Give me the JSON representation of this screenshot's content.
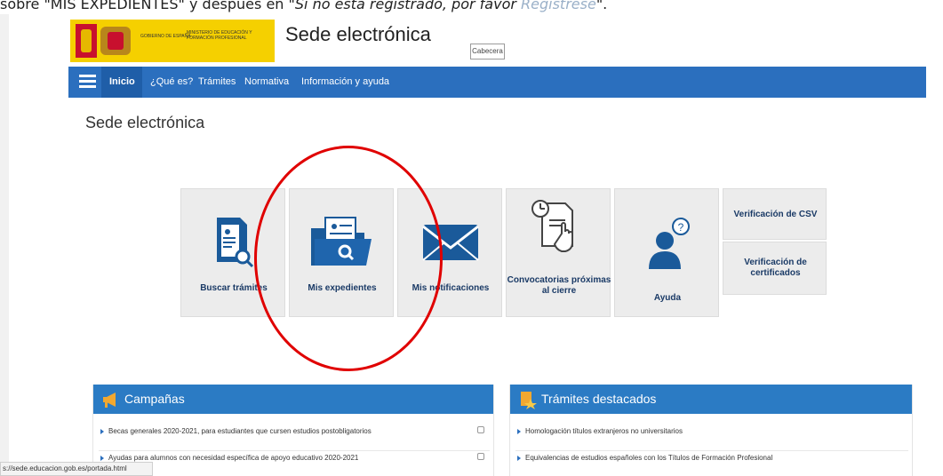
{
  "caption": {
    "prefix": "sobre \"MIS EXPEDIENTES\" y después en ",
    "italic": "\"Si no está registrado, por favor ",
    "link": "Regístrese",
    "suffix": "\"."
  },
  "header": {
    "logo_gobierno": "GOBIERNO DE ESPAÑA",
    "logo_ministerio": "MINISTERIO DE EDUCACIÓN Y FORMACIÓN PROFESIONAL",
    "site_title": "Sede electrónica",
    "cabecera": "Cabecera"
  },
  "nav": {
    "items": [
      "Inicio",
      "¿Qué es?",
      "Trámites",
      "Normativa",
      "Información y ayuda"
    ]
  },
  "page_title": "Sede electrónica",
  "tiles": [
    {
      "label": "Buscar trámites",
      "icon": "search-document-icon"
    },
    {
      "label": "Mis expedientes",
      "icon": "folder-search-icon"
    },
    {
      "label": "Mis notificaciones",
      "icon": "envelope-icon"
    },
    {
      "label": "Convocatorias próximas al cierre",
      "icon": "clock-document-icon"
    },
    {
      "label": "Ayuda",
      "icon": "user-help-icon"
    }
  ],
  "small_tiles": [
    {
      "label": "Verificación de CSV"
    },
    {
      "label": "Verificación de certificados"
    }
  ],
  "panels": {
    "campanas": {
      "title": "Campañas",
      "icon": "megaphone-icon",
      "items": [
        "Becas generales 2020-2021, para estudiantes que cursen estudios postobligatorios",
        "Ayudas para alumnos con necesidad específica de apoyo educativo 2020-2021"
      ]
    },
    "tramites": {
      "title": "Trámites destacados",
      "icon": "star-document-icon",
      "items": [
        "Homologación títulos extranjeros no universitarios",
        "Equivalencias de estudios españoles con los Títulos de Formación Profesional"
      ]
    }
  },
  "status_url": "s://sede.educacion.gob.es/portada.html",
  "colors": {
    "navbar": "#2b6fbe",
    "panel_header": "#2b7bc4",
    "tile_bg": "#ececec",
    "icon_blue": "#1a5a9a",
    "highlight_circle": "#e00000"
  }
}
